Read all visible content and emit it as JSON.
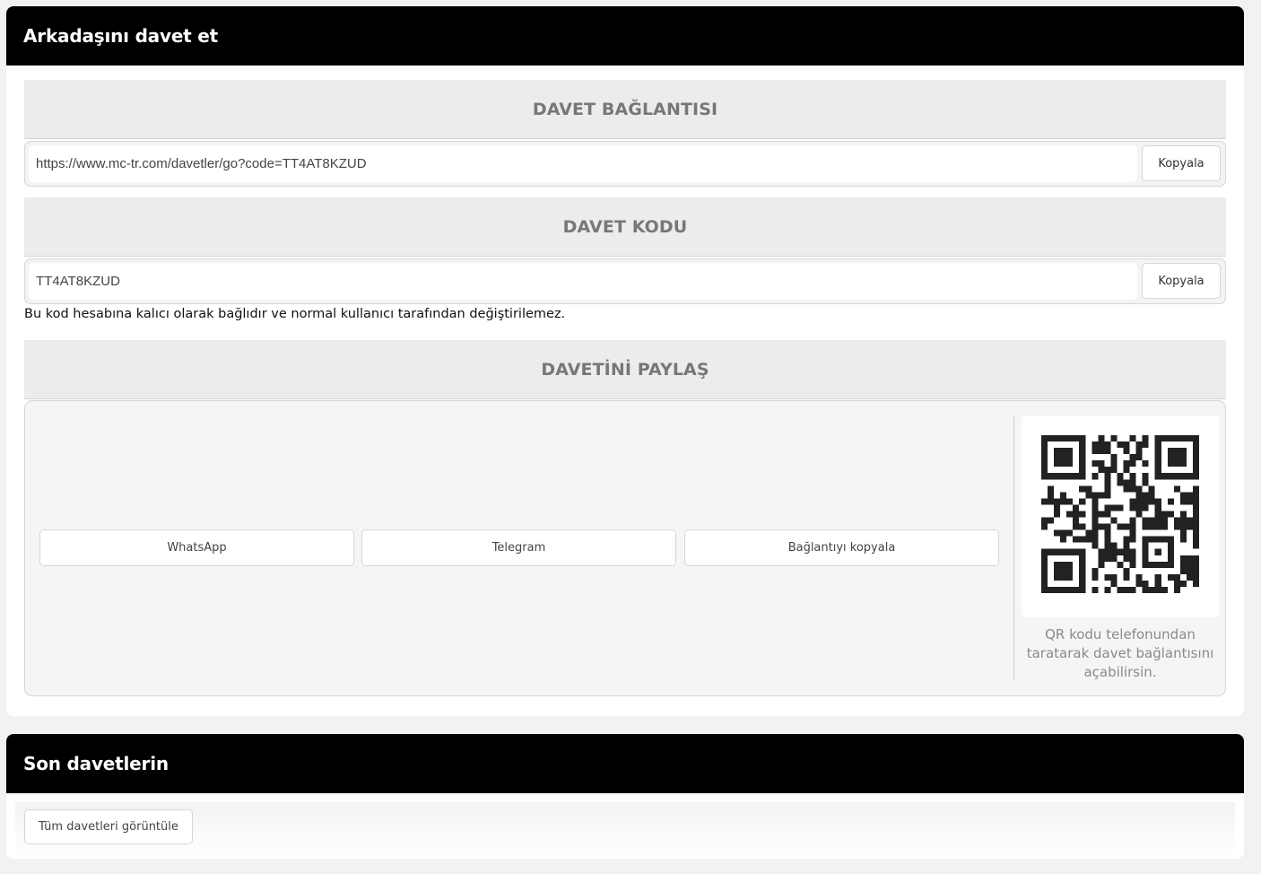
{
  "invite": {
    "title": "Arkadaşını davet et",
    "link_section": {
      "title": "DAVET BAĞLANTISI",
      "value": "https://www.mc-tr.com/davetler/go?code=TT4AT8KZUD",
      "copy_label": "Kopyala"
    },
    "code_section": {
      "title": "DAVET KODU",
      "value": "TT4AT8KZUD",
      "copy_label": "Kopyala",
      "note": "Bu kod hesabına kalıcı olarak bağlıdır ve normal kullanıcı tarafından değiştirilemez."
    },
    "share_section": {
      "title": "DAVETİNİ PAYLAŞ",
      "buttons": [
        "WhatsApp",
        "Telegram",
        "Bağlantıyı kopyala"
      ],
      "qr_caption": "QR kodu telefonundan taratarak davet bağlantısını açabilirsin."
    }
  },
  "recent": {
    "title": "Son davetlerin",
    "view_all_label": "Tüm davetleri görüntüle"
  },
  "colors": {
    "header_bg": "#000000",
    "section_bg": "#ececec",
    "section_title": "#777777"
  }
}
